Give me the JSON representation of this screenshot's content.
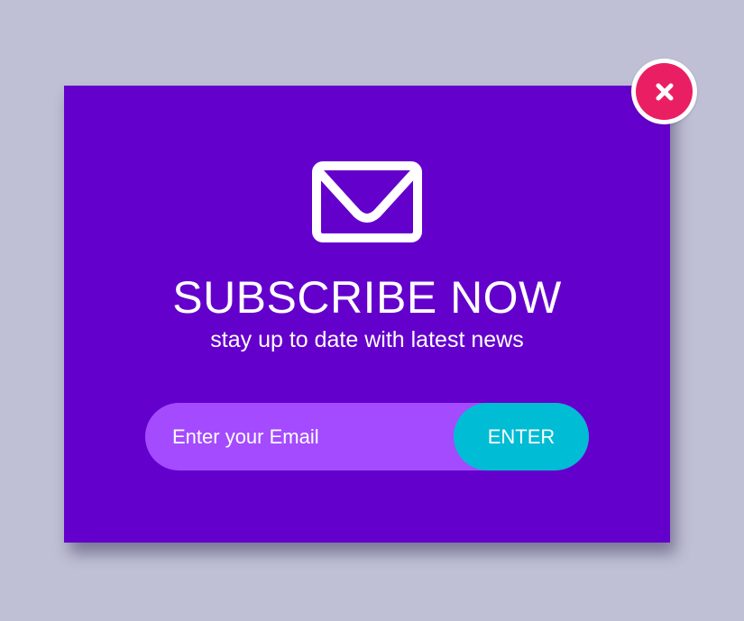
{
  "colors": {
    "page_background": "#bfc0d5",
    "modal_background": "#6400cc",
    "input_background": "#a44bff",
    "button_background": "#00bcd4",
    "close_button": "#ea1f63",
    "text": "#ffffff"
  },
  "modal": {
    "icon": "envelope-icon",
    "title": "SUBSCRIBE NOW",
    "subtitle": "stay up to date with latest news"
  },
  "form": {
    "email_placeholder": "Enter your Email",
    "email_value": "",
    "submit_label": "ENTER"
  },
  "close": {
    "icon": "close-icon"
  }
}
